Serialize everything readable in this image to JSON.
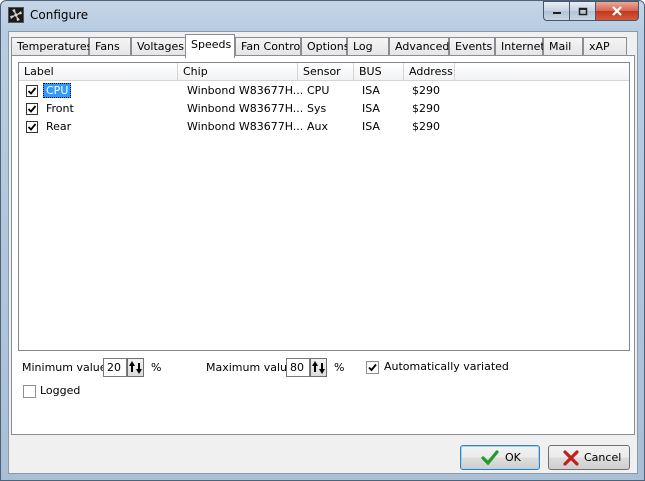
{
  "window": {
    "title": "Configure"
  },
  "icons": {
    "app": "fan-icon",
    "minimize": "minimize-icon",
    "maximize": "maximize-icon",
    "close": "close-icon",
    "ok": "checkmark-icon",
    "cancel": "x-icon"
  },
  "tabs": [
    {
      "label": "Temperatures",
      "selected": false
    },
    {
      "label": "Fans",
      "selected": false
    },
    {
      "label": "Voltages",
      "selected": false
    },
    {
      "label": "Speeds",
      "selected": true
    },
    {
      "label": "Fan Control",
      "selected": false
    },
    {
      "label": "Options",
      "selected": false
    },
    {
      "label": "Log",
      "selected": false
    },
    {
      "label": "Advanced",
      "selected": false
    },
    {
      "label": "Events",
      "selected": false
    },
    {
      "label": "Internet",
      "selected": false
    },
    {
      "label": "Mail",
      "selected": false
    },
    {
      "label": "xAP",
      "selected": false
    }
  ],
  "list": {
    "columns": [
      "Label",
      "Chip",
      "Sensor",
      "BUS",
      "Address"
    ],
    "rows": [
      {
        "checked": true,
        "label": "CPU",
        "chip": "Winbond W83677H...",
        "sensor": "CPU",
        "bus": "ISA",
        "address": "$290",
        "selected": true
      },
      {
        "checked": true,
        "label": "Front",
        "chip": "Winbond W83677H...",
        "sensor": "Sys",
        "bus": "ISA",
        "address": "$290",
        "selected": false
      },
      {
        "checked": true,
        "label": "Rear",
        "chip": "Winbond W83677H...",
        "sensor": "Aux",
        "bus": "ISA",
        "address": "$290",
        "selected": false
      }
    ]
  },
  "options": {
    "min_label": "Minimum value",
    "min_value": "20",
    "min_unit": "%",
    "max_label": "Maximum value",
    "max_value": "80",
    "max_unit": "%",
    "auto_label": "Automatically variated",
    "auto_checked": true,
    "logged_label": "Logged",
    "logged_checked": false
  },
  "buttons": {
    "ok": "OK",
    "cancel": "Cancel"
  },
  "colors": {
    "selection": "#3399ff",
    "ok_check": "#1f9a2c",
    "cancel_x": "#c0201a"
  }
}
